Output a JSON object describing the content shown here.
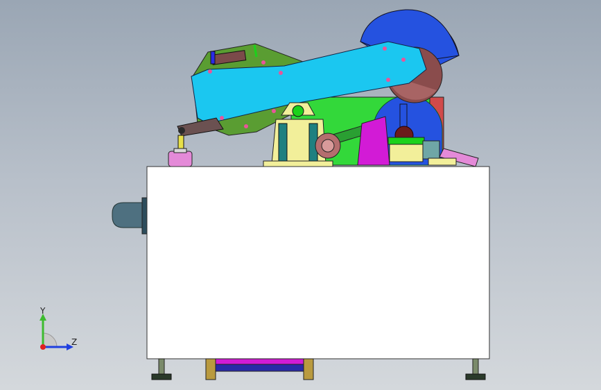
{
  "viewport": {
    "background_top": "#9aa6b4",
    "background_bottom": "#d4d8dc"
  },
  "triad": {
    "y_label": "Y",
    "z_label": "Z",
    "y_color": "#3dbb2f",
    "z_color": "#1f3fe0",
    "x_color": "#e02020"
  },
  "colors": {
    "arm": "#1bc7f0",
    "saw_blade": "#2552e0",
    "frame_green": "#33d83a",
    "housing_yellow": "#f2ef9a",
    "cabinet": "#ffffff",
    "base_magenta": "#d21bd6",
    "knob_pink": "#e48ad8",
    "teal_post": "#1f8080"
  }
}
